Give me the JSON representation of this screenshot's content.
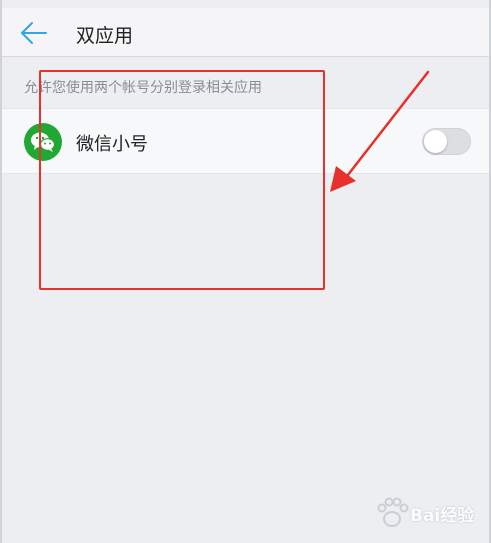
{
  "header": {
    "title": "双应用",
    "back_icon": "arrow-left-icon"
  },
  "section": {
    "hint": "允许您使用两个帐号分别登录相关应用"
  },
  "apps": [
    {
      "label": "微信小号",
      "icon": "wechat-icon",
      "enabled": false
    }
  ],
  "colors": {
    "accent": "#2fa7e0",
    "wechat_green": "#1fa934",
    "annotation_red": "#e8302c",
    "background": "#eceef1"
  },
  "watermark": {
    "text": "Bai经验"
  }
}
